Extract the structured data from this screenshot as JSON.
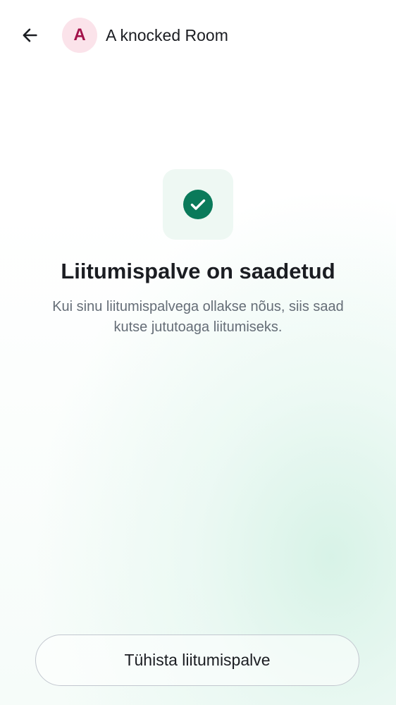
{
  "header": {
    "back_icon": "arrow-left-icon",
    "avatar_letter": "A",
    "room_name": "A knocked Room"
  },
  "status": {
    "icon": "check-circle-icon",
    "title": "Liitumispalve on saadetud",
    "description": "Kui sinu liitumispalvega ollakse nõus, siis saad kutse jututoaga liitumiseks."
  },
  "actions": {
    "cancel_label": "Tühista liitumispalve"
  },
  "colors": {
    "accent": "#0a7a5a",
    "avatar_bg": "#fbe3ea",
    "avatar_text": "#a3124a"
  }
}
